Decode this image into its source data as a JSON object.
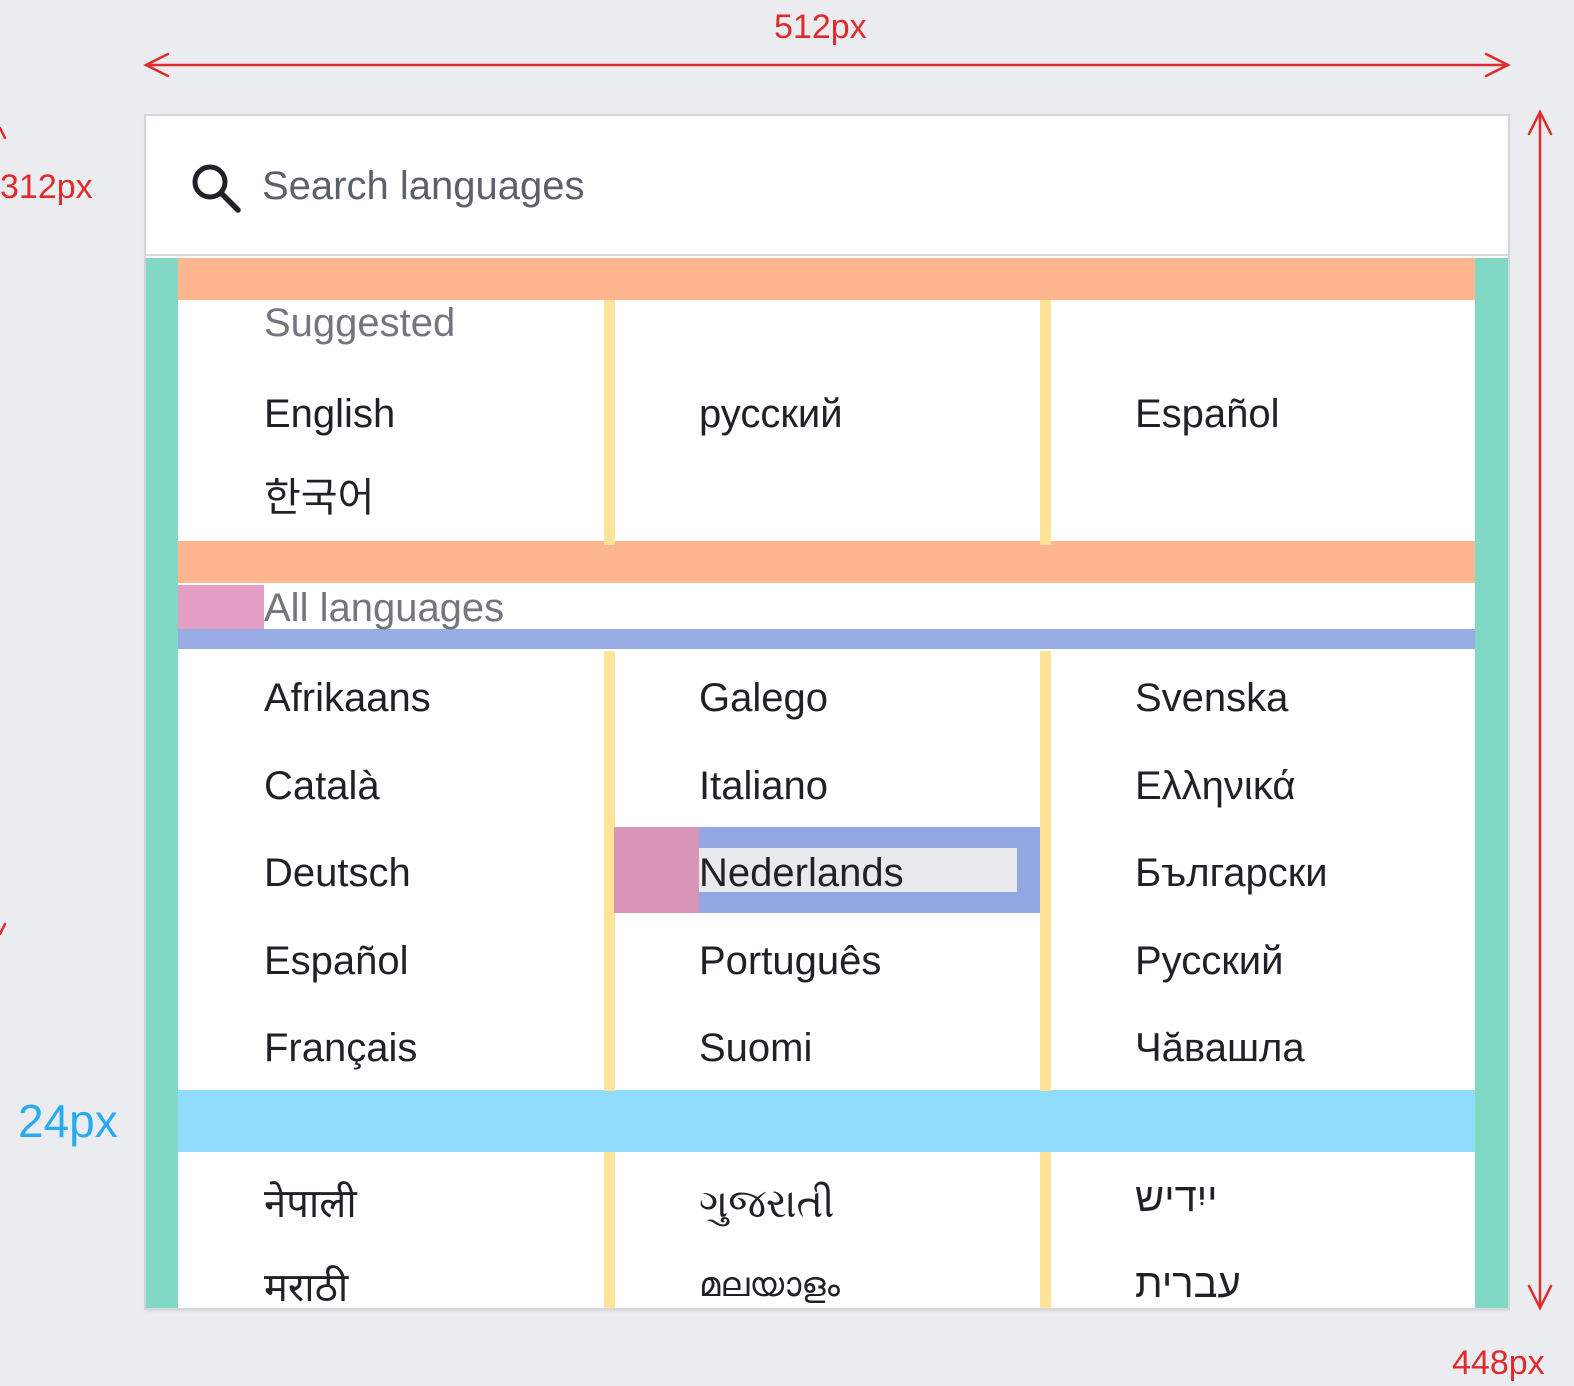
{
  "annotations": {
    "width_label": "512px",
    "height_label": "448px",
    "left_label": "312px",
    "gap_label": "24px",
    "colors": {
      "dimension": "#e02b2b",
      "gap": "#2aaaf2",
      "margin": "#80d8c5",
      "section_spacing": "#ffb68e",
      "column_gutter": "#ffe396",
      "heading_spacing": "#97ade3",
      "row_gap": "#90dcfc",
      "padding": "#e49fc4"
    }
  },
  "search": {
    "placeholder": "Search languages",
    "icon": "search-icon"
  },
  "suggested": {
    "heading": "Suggested",
    "columns": [
      [
        "English",
        "한국어"
      ],
      [
        "русский"
      ],
      [
        "Español"
      ]
    ]
  },
  "all_languages": {
    "heading": "All languages",
    "columns": [
      [
        "Afrikaans",
        "Català",
        "Deutsch",
        "Español",
        "Français"
      ],
      [
        "Galego",
        "Italiano",
        "Nederlands",
        "Português",
        "Suomi"
      ],
      [
        "Svenska",
        "Ελληνικά",
        "Български",
        "Русский",
        "Чăвашла"
      ]
    ],
    "focused_item": "Nederlands"
  },
  "more_languages": {
    "columns": [
      [
        "नेपाली",
        "मराठी"
      ],
      [
        "ગુજરાતી",
        "മലയാളം"
      ],
      [
        "ייִדיש",
        "עברית"
      ]
    ]
  }
}
